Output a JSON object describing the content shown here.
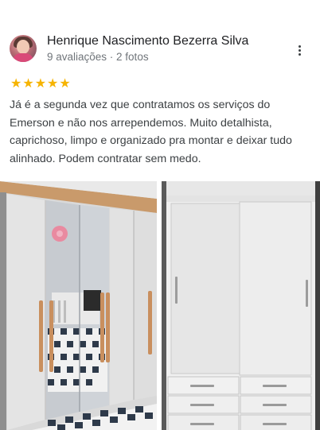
{
  "reviewer": {
    "name": "Henrique Nascimento Bezerra Silva",
    "meta": "9 avaliações · 2 fotos"
  },
  "rating": {
    "stars": 5,
    "color": "#f6b400"
  },
  "review": {
    "text": "Já é a segunda vez que contratamos os serviços do Emerson e não nos arrependemos. Muito detalhista, caprichoso, limpo e  organizado pra montar e deixar tudo alinhado. Podem contratar sem medo."
  },
  "icons": {
    "more": "more-vertical-icon",
    "star": "star-icon"
  }
}
